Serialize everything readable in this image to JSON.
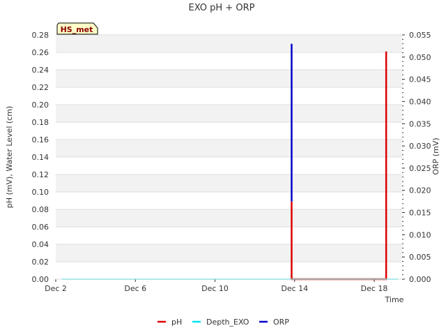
{
  "chart_data": {
    "type": "line",
    "title": "EXO pH + ORP",
    "badge": "HS_met",
    "xlabel": "Time",
    "ylabel_left": "pH (mV), Water Level (cm)",
    "ylabel_right": "ORP (mV)",
    "x_unit": "days",
    "xlim": [
      2.0,
      19.4
    ],
    "x_ticks": [
      {
        "value": 2,
        "label": "Dec 2"
      },
      {
        "value": 6,
        "label": "Dec 6"
      },
      {
        "value": 10,
        "label": "Dec 10"
      },
      {
        "value": 14,
        "label": "Dec 14"
      },
      {
        "value": 18,
        "label": "Dec 18"
      }
    ],
    "ylim_left": [
      0,
      0.28
    ],
    "y_ticks_left": [
      "0.00",
      "0.02",
      "0.04",
      "0.06",
      "0.08",
      "0.10",
      "0.12",
      "0.14",
      "0.16",
      "0.18",
      "0.20",
      "0.22",
      "0.24",
      "0.26",
      "0.28"
    ],
    "ylim_right": [
      0,
      0.055
    ],
    "y_ticks_right": [
      "0.000",
      "0.005",
      "0.010",
      "0.015",
      "0.020",
      "0.025",
      "0.030",
      "0.035",
      "0.040",
      "0.045",
      "0.050",
      "0.055"
    ],
    "grid": true,
    "legend_position": "bottom",
    "series": [
      {
        "name": "pH",
        "color": "#dd0000",
        "axis": "left",
        "points": [
          [
            13.85,
            0.0
          ],
          [
            13.85,
            0.089
          ],
          [
            13.85,
            0.0
          ],
          [
            18.6,
            0.0
          ],
          [
            18.6,
            0.261
          ],
          [
            18.6,
            0.0
          ]
        ]
      },
      {
        "name": "Depth_EXO",
        "color": "#00e5ee",
        "axis": "left",
        "points": [
          [
            2.3,
            0.0
          ],
          [
            19.2,
            0.0
          ]
        ]
      },
      {
        "name": "ORP",
        "color": "#0000cc",
        "axis": "right",
        "points": [
          [
            13.85,
            0.0175
          ],
          [
            13.85,
            0.053
          ]
        ]
      }
    ]
  }
}
